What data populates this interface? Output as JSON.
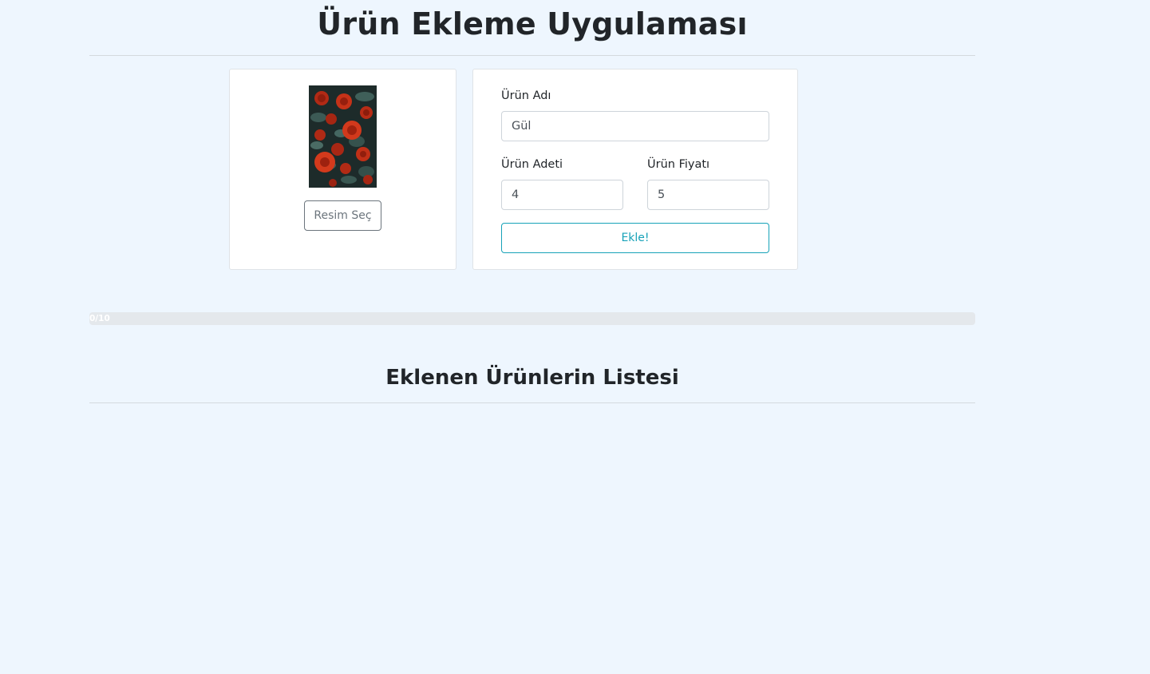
{
  "page": {
    "title": "Ürün Ekleme Uygulaması"
  },
  "image_card": {
    "image_alt": "Kırmızı güller",
    "select_button": "Resim Seç"
  },
  "form": {
    "name_label": "Ürün Adı",
    "name_value": "Gül",
    "quantity_label": "Ürün Adeti",
    "quantity_value": "4",
    "price_label": "Ürün Fiyatı",
    "price_value": "5",
    "submit_label": "Ekle!"
  },
  "progress": {
    "text": "0/10",
    "value": 0,
    "max": 10
  },
  "list": {
    "title": "Eklenen Ürünlerin Listesi",
    "items": []
  },
  "colors": {
    "background": "#eef6fe",
    "accent": "#17a2b8",
    "secondary": "#6c757d"
  },
  "icons": {
    "product_image": "rose-photo"
  }
}
